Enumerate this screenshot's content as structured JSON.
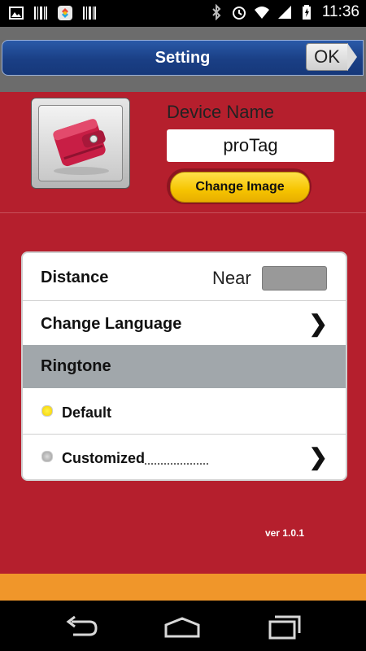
{
  "statusbar": {
    "time": "11:36",
    "icons": [
      "image-icon",
      "barcode-icon",
      "app-icon",
      "barcode-icon",
      "bluetooth-icon",
      "alarm-icon",
      "wifi-icon",
      "signal-icon",
      "battery-icon"
    ]
  },
  "header": {
    "title": "Setting",
    "ok_label": "OK",
    "accent": "#1a3f85"
  },
  "device": {
    "name_label": "Device Name",
    "name_value": "proTag",
    "change_image_label": "Change Image"
  },
  "settings": {
    "distance_label": "Distance",
    "distance_value": "Near",
    "change_language_label": "Change Language",
    "ringtone_label": "Ringtone",
    "chevron": "❯",
    "options": [
      {
        "label": "Default",
        "selected": true
      },
      {
        "label": "Customized",
        "selected": false
      }
    ]
  },
  "version": "ver 1.0.1",
  "colors": {
    "background": "#b51f2d",
    "footer": "#f0962a",
    "button": "#f6c400"
  },
  "nav": {
    "icons": [
      "back-icon",
      "home-icon",
      "recents-icon"
    ]
  }
}
